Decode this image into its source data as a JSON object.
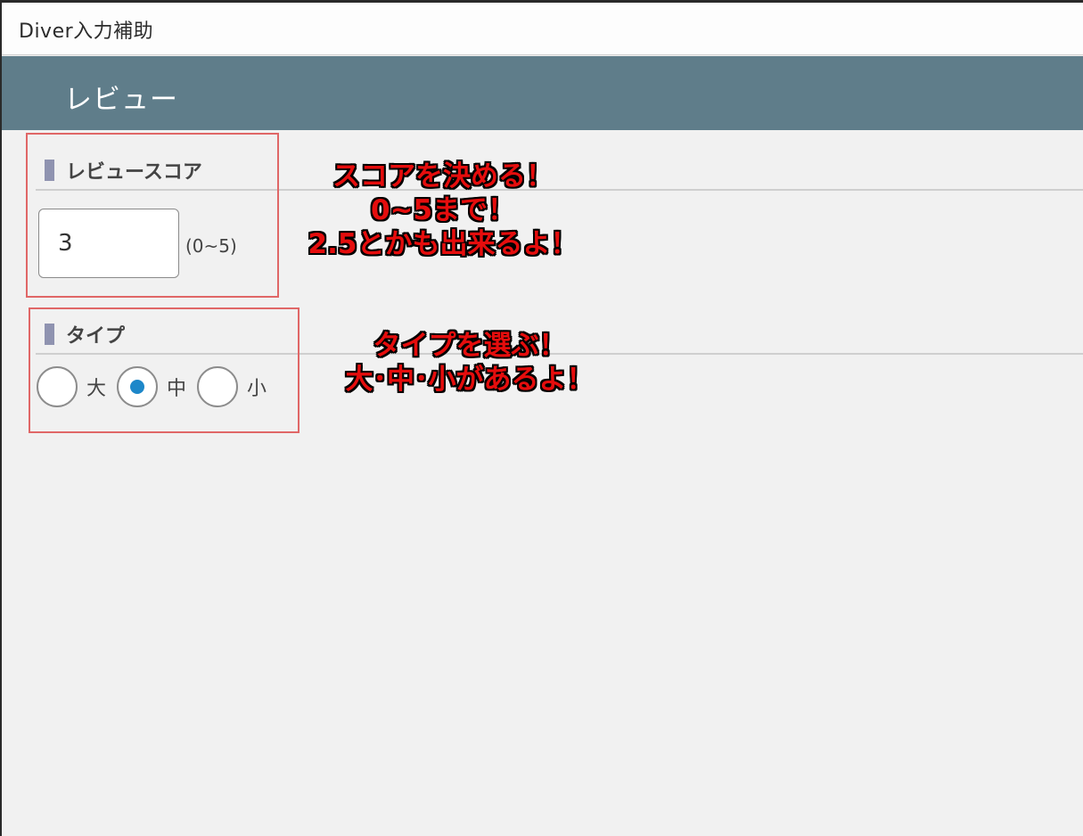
{
  "window": {
    "title": "Diver入力補助"
  },
  "header": {
    "title": "レビュー"
  },
  "review_score": {
    "section_title": "レビュースコア",
    "value": "3",
    "range_hint": "(0~5)"
  },
  "type": {
    "section_title": "タイプ",
    "options": [
      {
        "label": "大",
        "checked": false
      },
      {
        "label": "中",
        "checked": true
      },
      {
        "label": "小",
        "checked": false
      }
    ]
  },
  "annotations": {
    "score_lines": [
      "スコアを決める！",
      "0~5まで！",
      "2.5とかも出来るよ！"
    ],
    "type_lines": [
      "タイプを選ぶ！",
      "大･中･小があるよ！"
    ]
  },
  "colors": {
    "header_bg": "#5f7d8a",
    "radio_selected": "#1d87c9",
    "annotation_text": "#e50d0d",
    "annotation_box": "#e06767",
    "section_bar": "#8f93b0"
  }
}
